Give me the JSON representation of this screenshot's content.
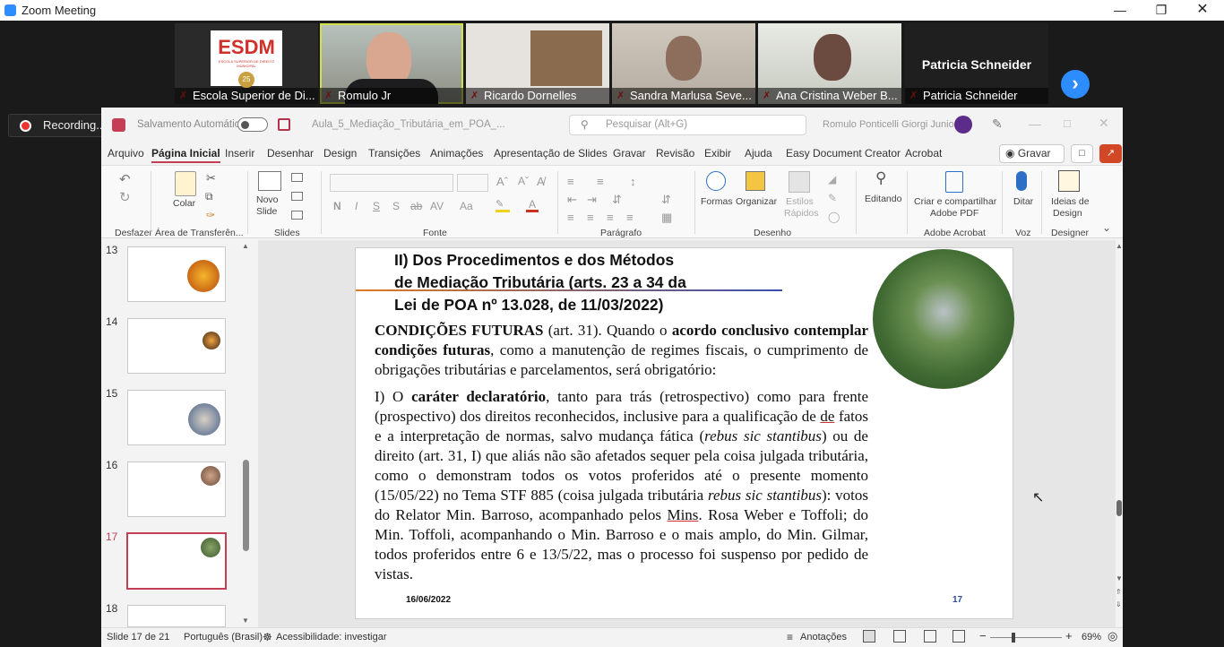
{
  "window": {
    "title": "Zoom Meeting"
  },
  "participants": [
    {
      "name": "Escola Superior de Di..."
    },
    {
      "name": "Romulo Jr"
    },
    {
      "name": "Ricardo Dornelles"
    },
    {
      "name": "Sandra Marlusa Seve..."
    },
    {
      "name": "Ana Cristina Weber B..."
    },
    {
      "name": "Patricia Schneider"
    }
  ],
  "logo": {
    "text": "ESDM",
    "sub": "ESCOLA SUPERIOR DE DIREITO MUNICIPAL",
    "badge": "25"
  },
  "featured": {
    "name": "Patricia Schneider"
  },
  "recording": {
    "label": "Recording..."
  },
  "ppt": {
    "autosave": "Salvamento Automático",
    "filename": "Aula_5_Mediação_Tributária_em_POA_...",
    "search_placeholder": "Pesquisar (Alt+G)",
    "user": "Romulo Ponticelli Giorgi Junior",
    "tabs": [
      "Arquivo",
      "Página Inicial",
      "Inserir",
      "Desenhar",
      "Design",
      "Transições",
      "Animações",
      "Apresentação de Slides",
      "Gravar",
      "Revisão",
      "Exibir",
      "Ajuda",
      "Easy Document Creator",
      "Acrobat"
    ],
    "gravar": "Gravar",
    "groups": {
      "undo": "Desfazer",
      "clipboard": "Área de Transferên...",
      "slides": "Slides",
      "font": "Fonte",
      "paragraph": "Parágrafo",
      "drawing": "Desenho",
      "acrobat": "Adobe Acrobat",
      "voice": "Voz",
      "designer": "Designer"
    },
    "buttons": {
      "paste": "Colar",
      "new_slide": "Novo",
      "new_slide2": "Slide",
      "shapes": "Formas",
      "arrange": "Organizar",
      "styles1": "Estilos",
      "styles2": "Rápidos",
      "editing": "Editando",
      "create_pdf1": "Criar e compartilhar",
      "create_pdf2": "Adobe PDF",
      "dictate": "Ditar",
      "ideas1": "Ideias de",
      "ideas2": "Design"
    },
    "slide_numbers": [
      "13",
      "14",
      "15",
      "16",
      "17",
      "18"
    ],
    "slide": {
      "heading": [
        "II)    Dos Procedimentos e dos Métodos",
        "de Mediação Tributária (arts. 23 a 34 da",
        "Lei de POA nº 13.028, de 11/03/2022)"
      ],
      "date": "16/06/2022",
      "page": "17"
    },
    "status": {
      "slide": "Slide 17 de 21",
      "lang": "Português (Brasil)",
      "access": "Acessibilidade: investigar",
      "notes": "Anotações",
      "zoom": "69%"
    }
  },
  "colors": {
    "accent": "#c43e56",
    "zoom_blue": "#2d8cff"
  }
}
